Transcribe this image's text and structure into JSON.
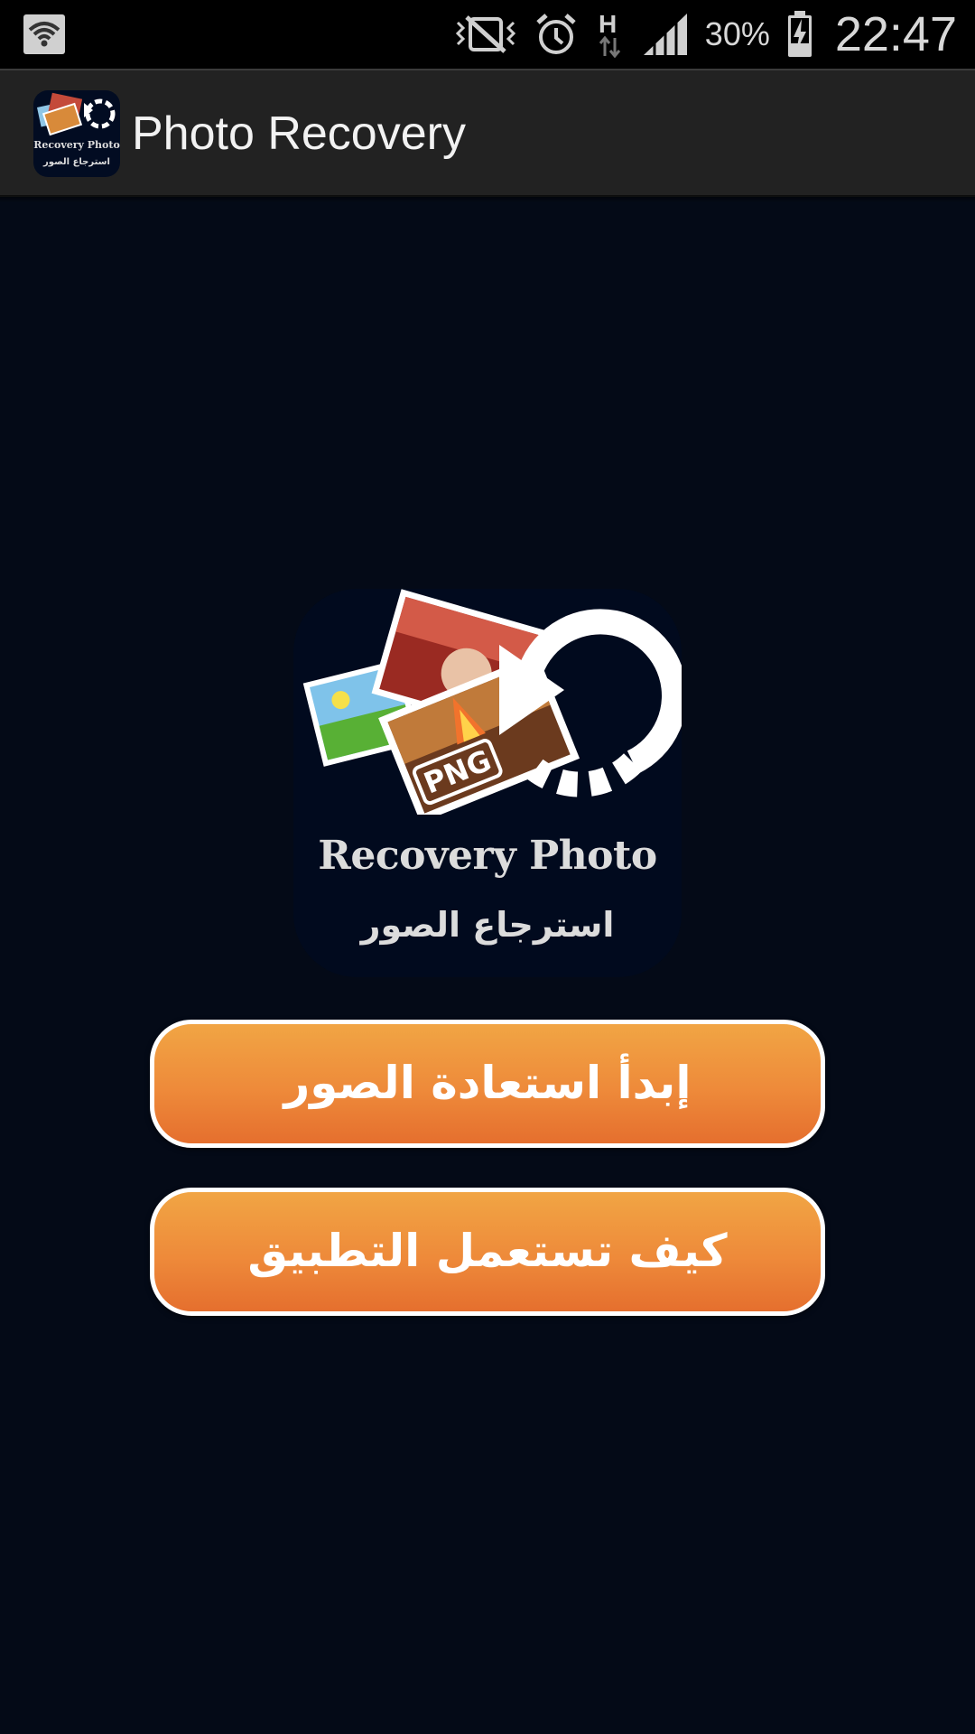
{
  "status_bar": {
    "battery_percent": "30%",
    "time": "22:47",
    "network_type": "H",
    "icons": [
      "wifi-icon",
      "mute-vibrate-icon",
      "alarm-icon",
      "network-h-icon",
      "signal-icon",
      "battery-charging-icon"
    ]
  },
  "action_bar": {
    "title": "Photo Recovery",
    "icon": "app-logo-icon"
  },
  "logo": {
    "text_en": "Recovery Photo",
    "text_ar": "استرجاع الصور",
    "badge": "PNG"
  },
  "buttons": {
    "start_recovery": "إبدأ استعادة الصور",
    "how_to_use": "كيف تستعمل التطبيق"
  },
  "colors": {
    "background": "#040a17",
    "button_top": "#f1a544",
    "button_bottom": "#e56f2e",
    "action_bar": "#222222"
  }
}
